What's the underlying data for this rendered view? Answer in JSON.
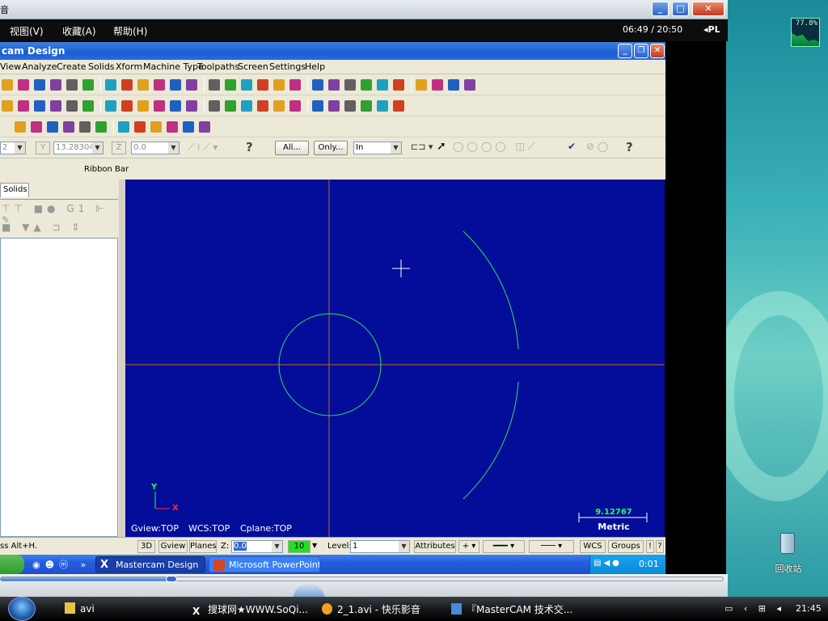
{
  "player": {
    "title_char": "音",
    "menu": [
      "视图(V)",
      "收藏(A)",
      "帮助(H)"
    ],
    "time": "06:49 / 20:50",
    "pl_label": "◂PL",
    "buttons": [
      "_",
      "□",
      "✕"
    ]
  },
  "desktop": {
    "cpu_meter": "77.8%",
    "recycle_bin_label": "回收站"
  },
  "mastercam": {
    "title": "cam Design",
    "menu": [
      "View",
      "Analyze",
      "Create",
      "Solids",
      "Xform",
      "Machine Type",
      "Toolpaths",
      "Screen",
      "Settings",
      "Help"
    ],
    "fields": {
      "x_value": "2",
      "y_label": "Y",
      "y_value": "13.28304",
      "z_label": "Z",
      "z_value": "0.0",
      "all_button": "All...",
      "only_button": "Only...",
      "selection_mode": "In"
    },
    "ribbon_bar_label": "Ribbon Bar",
    "left_tab": "Solids",
    "viewport": {
      "background": "#030d9a",
      "axis_y_label": "Y",
      "axis_x_label": "X",
      "gview": "Gview:TOP",
      "wcs": "WCS:TOP",
      "cplane": "Cplane:TOP",
      "scale_value": "9.12767",
      "scale_unit": "Metric"
    },
    "status": {
      "hint": "ss Alt+H.",
      "mode_3d": "3D",
      "gview": "Gview",
      "planes": "Planes",
      "z_label": "Z:",
      "z_value": "0.0",
      "color_value": "10",
      "level_label": "Level:",
      "level_value": "1",
      "attributes": "Attributes",
      "wcs": "WCS",
      "groups": "Groups",
      "bang": "!",
      "question": "?"
    }
  },
  "xp_taskbar": {
    "tasks": [
      "Mastercam Design",
      "Microsoft PowerPoint ..."
    ],
    "clock": "0:01"
  },
  "vista_taskbar": {
    "items": [
      "avi",
      "搜球网★WWW.SoQi...",
      "2_1.avi - 快乐影音",
      "『MasterCAM 技术交..."
    ],
    "clock": "21:45"
  }
}
